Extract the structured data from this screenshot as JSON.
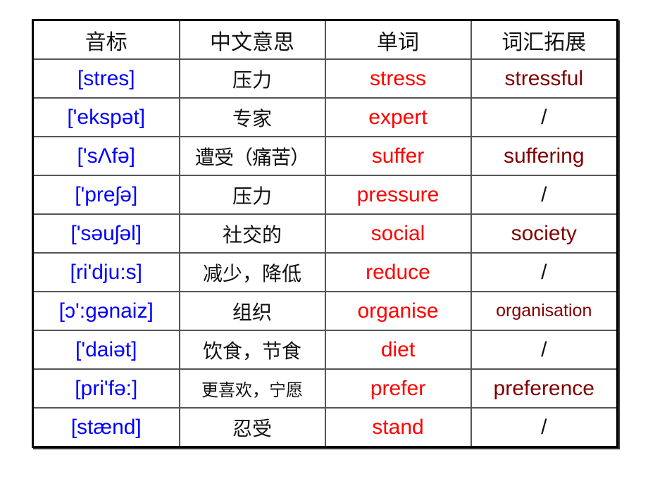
{
  "colors": {
    "phonetic": "#0000ff",
    "word": "#ff0000",
    "extension": "#800000",
    "slash": "#111111"
  },
  "headers": [
    "音标",
    "中文意思",
    "单词",
    "词汇拓展"
  ],
  "rows": [
    {
      "phonetic": "[stres]",
      "chinese": "压力",
      "word": "stress",
      "extension": "stressful"
    },
    {
      "phonetic": "['ekspət]",
      "chinese": "专家",
      "word": "expert",
      "extension": "/"
    },
    {
      "phonetic": "['sΛfə]",
      "chinese": "遭受（痛苦）",
      "word": "suffer",
      "extension": "suffering"
    },
    {
      "phonetic": "['preʃə]",
      "chinese": "压力",
      "word": "pressure",
      "extension": "/"
    },
    {
      "phonetic": "['səuʃəl]",
      "chinese": "社交的",
      "word": "social",
      "extension": "society"
    },
    {
      "phonetic": "[ri'dju:s]",
      "chinese": "减少，降低",
      "word": "reduce",
      "extension": "/"
    },
    {
      "phonetic": "[ɔ':gənaiz]",
      "chinese": "组织",
      "word": "organise",
      "extension": "organisation"
    },
    {
      "phonetic": "['daiət]",
      "chinese": "饮食，节食",
      "word": "diet",
      "extension": "/"
    },
    {
      "phonetic": "[pri'fə:]",
      "chinese": "更喜欢，宁愿",
      "word": "prefer",
      "extension": "preference"
    },
    {
      "phonetic": "[stænd]",
      "chinese": "忍受",
      "word": "stand",
      "extension": "/"
    }
  ]
}
